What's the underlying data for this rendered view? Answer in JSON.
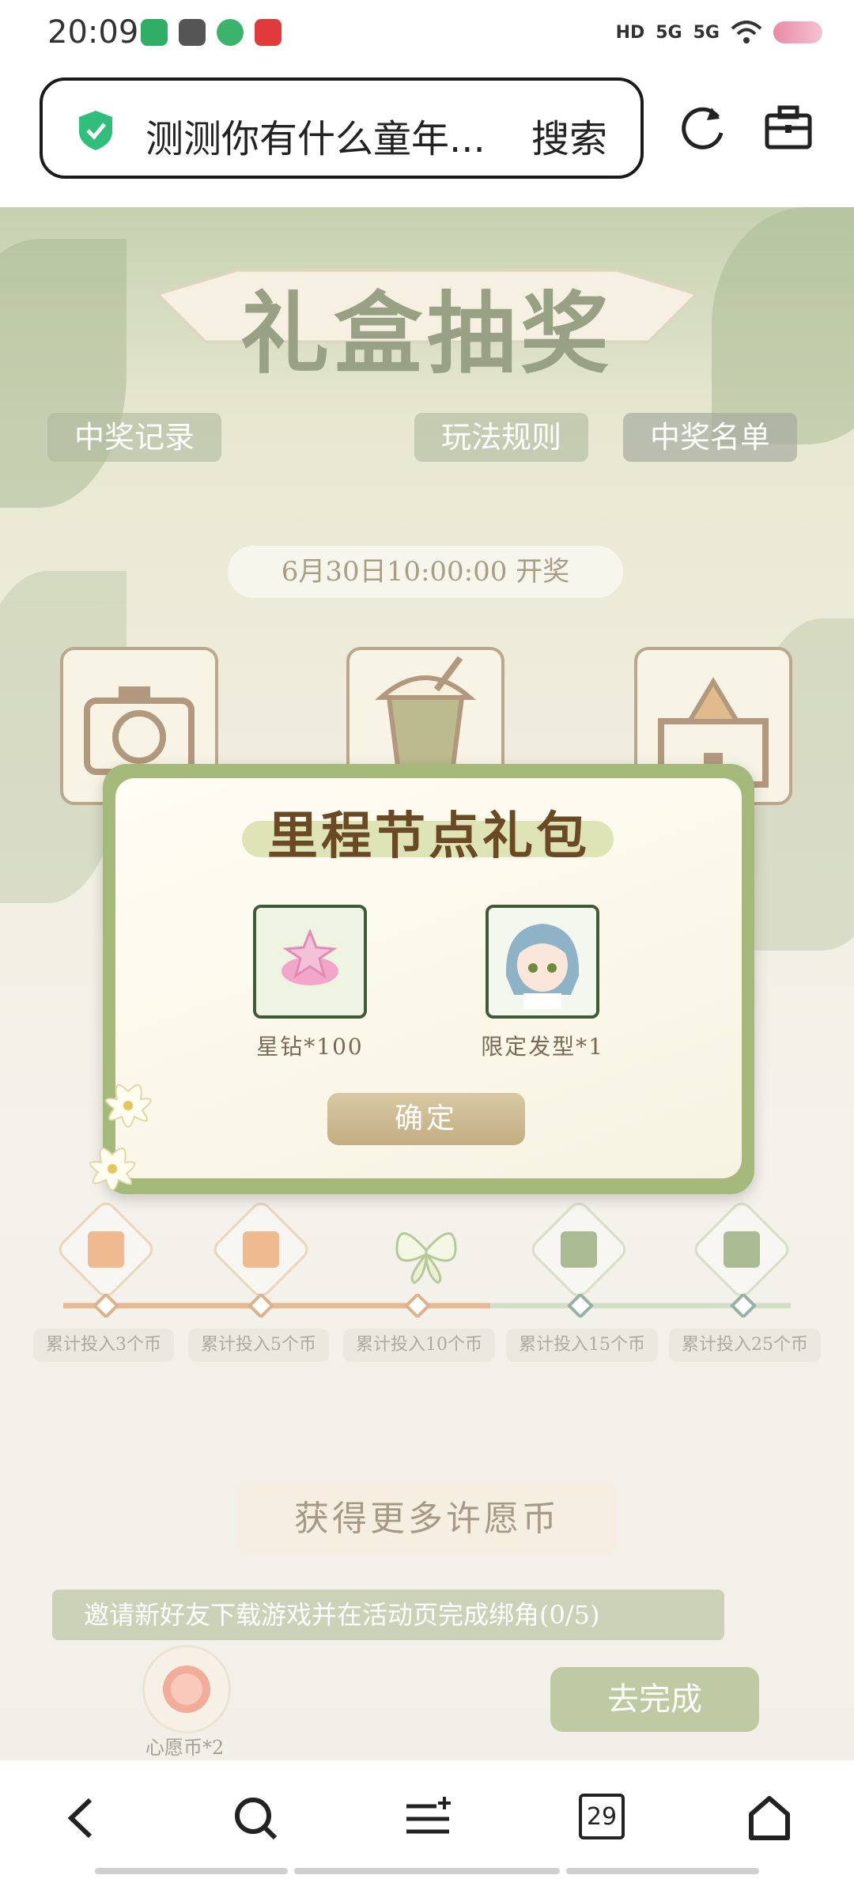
{
  "status_bar": {
    "time": "20:09",
    "signal_1": "HD",
    "signal_2": "5G",
    "signal_3": "5G"
  },
  "browser": {
    "search_text": "测测你有什么童年...",
    "search_button": "搜索"
  },
  "game": {
    "title": "礼盒抽奖",
    "tabs": [
      "中奖记录",
      "玩法规则",
      "中奖名单"
    ],
    "draw_time": "6月30日10:00:00 开奖",
    "milestones": [
      "累计投入3个币",
      "累计投入5个币",
      "累计投入10个币",
      "累计投入15个币",
      "累计投入25个币"
    ],
    "more_coins_title": "获得更多许愿币",
    "task_text": "邀请新好友下载游戏并在活动页完成绑角(0/5)",
    "task_reward": "心愿币*2",
    "task_button": "去完成"
  },
  "modal": {
    "title": "里程节点礼包",
    "items": [
      {
        "label": "星钻*100"
      },
      {
        "label": "限定发型*1"
      }
    ],
    "confirm": "确定"
  },
  "bottom_nav": {
    "tab_count": "29"
  },
  "colors": {
    "accent_green": "#8ea45f",
    "frame_green": "#a4b97a",
    "title_brown": "#6a4a25"
  }
}
